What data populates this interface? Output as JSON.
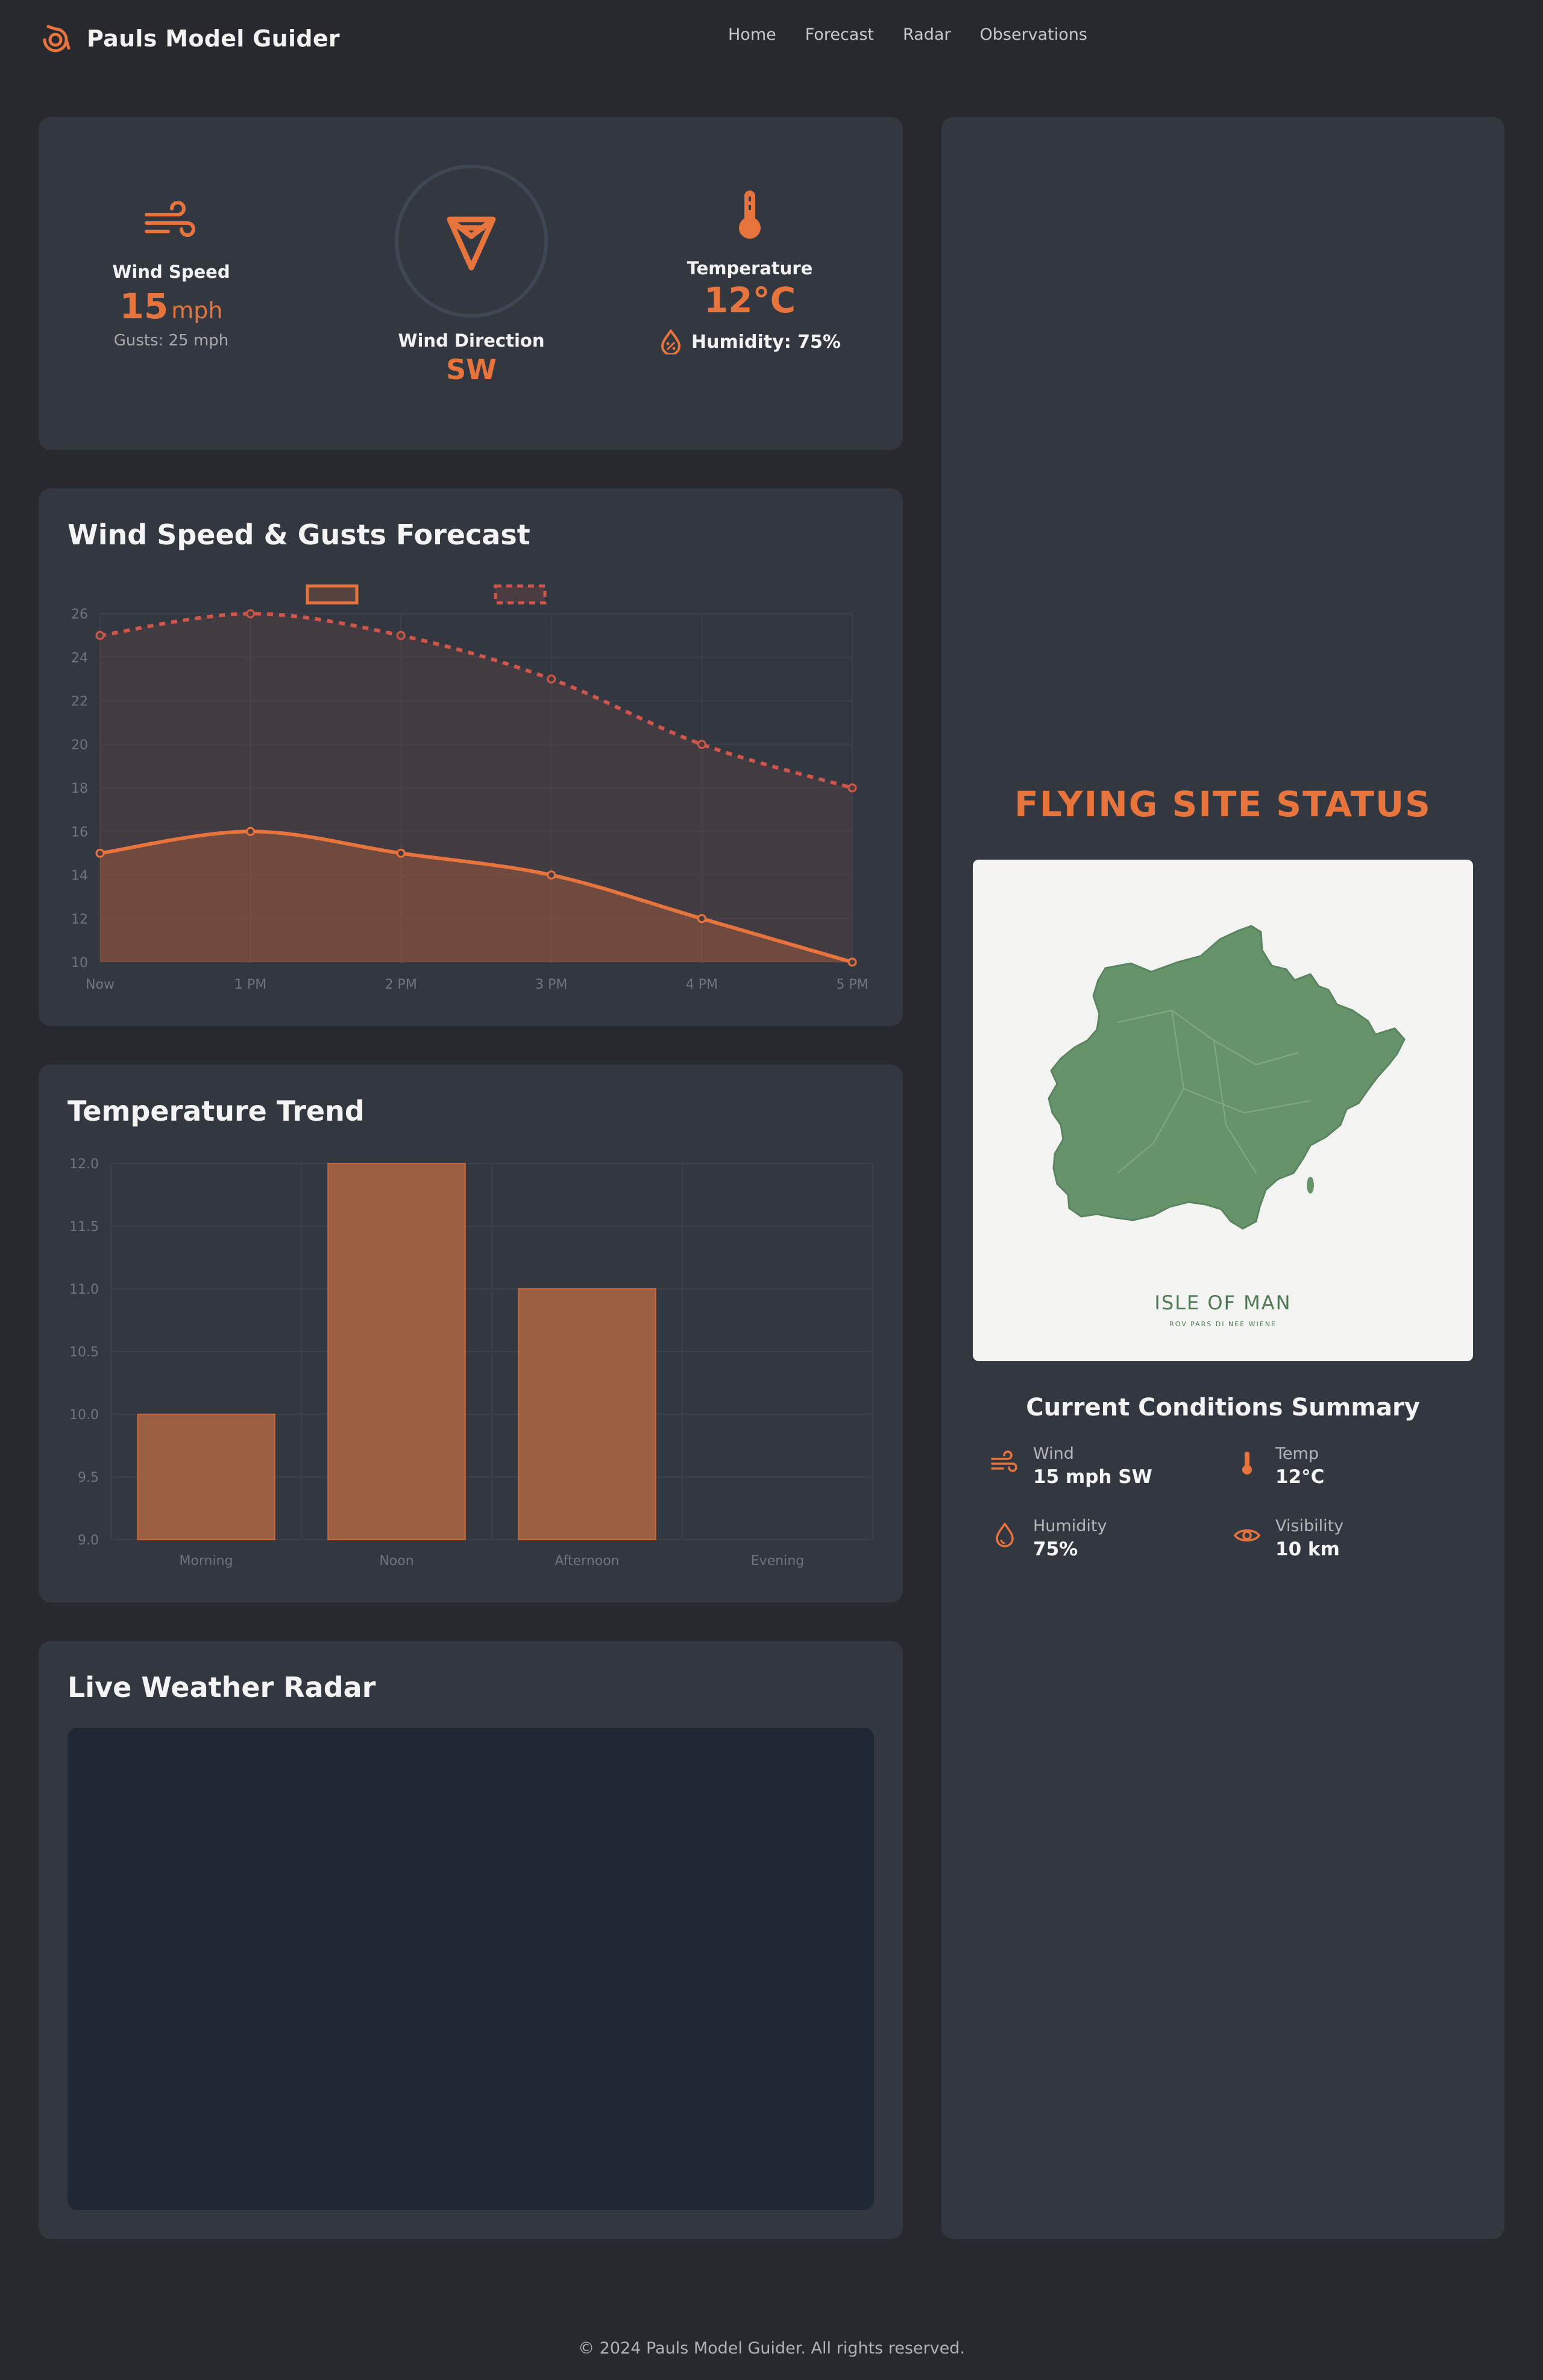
{
  "app": {
    "name": "Pauls Model Guider"
  },
  "nav": {
    "items": [
      "Home",
      "Forecast",
      "Radar",
      "Observations"
    ]
  },
  "current": {
    "wind_speed_label": "Wind Speed",
    "wind_speed_value": "15",
    "wind_speed_unit": "mph",
    "gusts": "Gusts: 25 mph",
    "wind_direction_label": "Wind Direction",
    "wind_direction_value": "SW",
    "temperature_label": "Temperature",
    "temperature_value": "12°C",
    "humidity": "Humidity: 75%"
  },
  "wind_chart": {
    "title": "Wind Speed & Gusts Forecast",
    "chart_data": {
      "type": "line",
      "x": [
        "Now",
        "1 PM",
        "2 PM",
        "3 PM",
        "4 PM",
        "5 PM"
      ],
      "series": [
        {
          "values": [
            15,
            16,
            15,
            14,
            12,
            10
          ],
          "color": "#e8743d",
          "style": "solid",
          "fill": true
        },
        {
          "values": [
            25,
            26,
            25,
            23,
            20,
            18
          ],
          "color": "#d0554a",
          "style": "dashed",
          "fill": true
        }
      ],
      "ylim": [
        10,
        26
      ],
      "yticks": [
        10,
        12,
        14,
        16,
        18,
        20,
        22,
        24,
        26
      ],
      "grid": true
    }
  },
  "temp_chart": {
    "title": "Temperature Trend",
    "chart_data": {
      "type": "bar",
      "categories": [
        "Morning",
        "Noon",
        "Afternoon",
        "Evening"
      ],
      "values": [
        10,
        12,
        11,
        9
      ],
      "ylim": [
        9,
        12
      ],
      "yticks": [
        "9.0",
        "9.5",
        "10.0",
        "10.5",
        "11.0",
        "11.5",
        "12.0"
      ],
      "color": "#9c5f42",
      "grid": true
    }
  },
  "radar": {
    "title": "Live Weather Radar"
  },
  "status": {
    "title": "FLYING SITE STATUS",
    "map_title": "ISLE OF MAN",
    "map_subtitle": "ROV PARS DI NEE WIENE",
    "summary_title": "Current Conditions Summary",
    "items": [
      {
        "label": "Wind",
        "value": "15 mph SW",
        "icon": "wind-icon"
      },
      {
        "label": "Temp",
        "value": "12°C",
        "icon": "thermometer-icon"
      },
      {
        "label": "Humidity",
        "value": "75%",
        "icon": "droplet-icon"
      },
      {
        "label": "Visibility",
        "value": "10 km",
        "icon": "eye-icon"
      }
    ]
  },
  "footer": {
    "text": "© 2024 Pauls Model Guider. All rights reserved."
  },
  "colors": {
    "accent": "#e8743d",
    "card": "#333840",
    "background": "#28292e"
  }
}
